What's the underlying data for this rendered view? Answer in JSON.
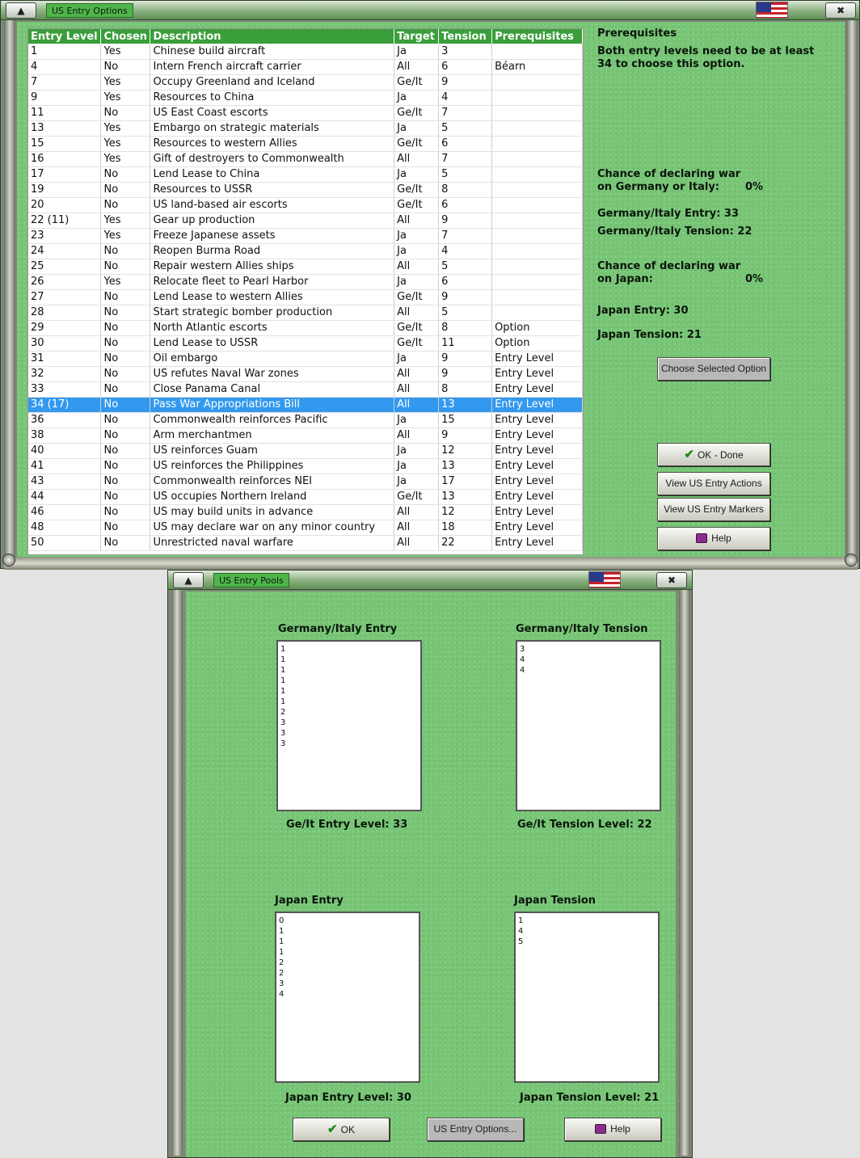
{
  "options_window": {
    "title": "US Entry Options",
    "columns": [
      "Entry Level",
      "Chosen",
      "Description",
      "Target",
      "Tension",
      "Prerequisites"
    ],
    "rows": [
      {
        "level": "1",
        "chosen": "Yes",
        "desc": "Chinese build aircraft",
        "target": "Ja",
        "tension": "3",
        "prereq": ""
      },
      {
        "level": "4",
        "chosen": "No",
        "desc": "Intern French aircraft carrier",
        "target": "All",
        "tension": "6",
        "prereq": "Béarn"
      },
      {
        "level": "7",
        "chosen": "Yes",
        "desc": "Occupy Greenland and Iceland",
        "target": "Ge/It",
        "tension": "9",
        "prereq": ""
      },
      {
        "level": "9",
        "chosen": "Yes",
        "desc": "Resources to China",
        "target": "Ja",
        "tension": "4",
        "prereq": ""
      },
      {
        "level": "11",
        "chosen": "No",
        "desc": "US East Coast escorts",
        "target": "Ge/It",
        "tension": "7",
        "prereq": ""
      },
      {
        "level": "13",
        "chosen": "Yes",
        "desc": "Embargo on strategic materials",
        "target": "Ja",
        "tension": "5",
        "prereq": ""
      },
      {
        "level": "15",
        "chosen": "Yes",
        "desc": "Resources to western Allies",
        "target": "Ge/It",
        "tension": "6",
        "prereq": ""
      },
      {
        "level": "16",
        "chosen": "Yes",
        "desc": "Gift of destroyers to Commonwealth",
        "target": "All",
        "tension": "7",
        "prereq": ""
      },
      {
        "level": "17",
        "chosen": "No",
        "desc": "Lend Lease to China",
        "target": "Ja",
        "tension": "5",
        "prereq": ""
      },
      {
        "level": "19",
        "chosen": "No",
        "desc": "Resources to USSR",
        "target": "Ge/It",
        "tension": "8",
        "prereq": ""
      },
      {
        "level": "20",
        "chosen": "No",
        "desc": "US land-based air escorts",
        "target": "Ge/It",
        "tension": "6",
        "prereq": ""
      },
      {
        "level": "22 (11)",
        "chosen": "Yes",
        "desc": "Gear up production",
        "target": "All",
        "tension": "9",
        "prereq": ""
      },
      {
        "level": "23",
        "chosen": "Yes",
        "desc": "Freeze Japanese assets",
        "target": "Ja",
        "tension": "7",
        "prereq": ""
      },
      {
        "level": "24",
        "chosen": "No",
        "desc": "Reopen Burma Road",
        "target": "Ja",
        "tension": "4",
        "prereq": ""
      },
      {
        "level": "25",
        "chosen": "No",
        "desc": "Repair western Allies ships",
        "target": "All",
        "tension": "5",
        "prereq": ""
      },
      {
        "level": "26",
        "chosen": "Yes",
        "desc": "Relocate fleet to Pearl Harbor",
        "target": "Ja",
        "tension": "6",
        "prereq": ""
      },
      {
        "level": "27",
        "chosen": "No",
        "desc": "Lend Lease to western Allies",
        "target": "Ge/It",
        "tension": "9",
        "prereq": ""
      },
      {
        "level": "28",
        "chosen": "No",
        "desc": "Start strategic bomber production",
        "target": "All",
        "tension": "5",
        "prereq": ""
      },
      {
        "level": "29",
        "chosen": "No",
        "desc": "North Atlantic escorts",
        "target": "Ge/It",
        "tension": "8",
        "prereq": "Option"
      },
      {
        "level": "30",
        "chosen": "No",
        "desc": "Lend Lease to USSR",
        "target": "Ge/It",
        "tension": "11",
        "prereq": "Option"
      },
      {
        "level": "31",
        "chosen": "No",
        "desc": "Oil embargo",
        "target": "Ja",
        "tension": "9",
        "prereq": "Entry Level"
      },
      {
        "level": "32",
        "chosen": "No",
        "desc": "US refutes Naval War zones",
        "target": "All",
        "tension": "9",
        "prereq": "Entry Level"
      },
      {
        "level": "33",
        "chosen": "No",
        "desc": "Close Panama Canal",
        "target": "All",
        "tension": "8",
        "prereq": "Entry Level"
      },
      {
        "level": "34 (17)",
        "chosen": "No",
        "desc": "Pass War Appropriations Bill",
        "target": "All",
        "tension": "13",
        "prereq": "Entry Level",
        "selected": true
      },
      {
        "level": "36",
        "chosen": "No",
        "desc": "Commonwealth reinforces Pacific",
        "target": "Ja",
        "tension": "15",
        "prereq": "Entry Level"
      },
      {
        "level": "38",
        "chosen": "No",
        "desc": "Arm merchantmen",
        "target": "All",
        "tension": "9",
        "prereq": "Entry Level"
      },
      {
        "level": "40",
        "chosen": "No",
        "desc": "US reinforces Guam",
        "target": "Ja",
        "tension": "12",
        "prereq": "Entry Level"
      },
      {
        "level": "41",
        "chosen": "No",
        "desc": "US reinforces the Philippines",
        "target": "Ja",
        "tension": "13",
        "prereq": "Entry Level"
      },
      {
        "level": "43",
        "chosen": "No",
        "desc": "Commonwealth reinforces NEI",
        "target": "Ja",
        "tension": "17",
        "prereq": "Entry Level"
      },
      {
        "level": "44",
        "chosen": "No",
        "desc": "US occupies Northern Ireland",
        "target": "Ge/It",
        "tension": "13",
        "prereq": "Entry Level"
      },
      {
        "level": "46",
        "chosen": "No",
        "desc": "US may build units in advance",
        "target": "All",
        "tension": "12",
        "prereq": "Entry Level"
      },
      {
        "level": "48",
        "chosen": "No",
        "desc": "US may declare war on any minor country",
        "target": "All",
        "tension": "18",
        "prereq": "Entry Level"
      },
      {
        "level": "50",
        "chosen": "No",
        "desc": "Unrestricted naval warfare",
        "target": "All",
        "tension": "22",
        "prereq": "Entry Level"
      }
    ],
    "side": {
      "prereq_title": "Prerequisites",
      "prereq_text_1": "Both entry levels need to be at least",
      "prereq_text_2": "34 to choose this option.",
      "chance_ge_1": "Chance of declaring war",
      "chance_ge_2": "on Germany or Italy:",
      "chance_ge_value": "0%",
      "ge_entry": "Germany/Italy Entry: 33",
      "ge_tension": "Germany/Italy Tension: 22",
      "chance_ja_1": "Chance of declaring war",
      "chance_ja_2": "on Japan:",
      "chance_ja_value": "0%",
      "ja_entry": "Japan Entry: 30",
      "ja_tension": "Japan Tension: 21"
    },
    "buttons": {
      "choose": "Choose Selected Option",
      "ok_done": "OK - Done",
      "view_actions": "View US Entry Actions",
      "view_markers": "View US Entry Markers",
      "help": "Help"
    }
  },
  "pools_window": {
    "title": "US Entry Pools",
    "ge_entry_label": "Germany/Italy Entry",
    "ge_entry_pool": [
      "1",
      "1",
      "1",
      "1",
      "1",
      "1",
      "2",
      "3",
      "3",
      "3"
    ],
    "ge_entry_level": "Ge/It Entry Level: 33",
    "ge_tension_label": "Germany/Italy Tension",
    "ge_tension_pool": [
      "3",
      "4",
      "4"
    ],
    "ge_tension_level": "Ge/It Tension Level: 22",
    "ja_entry_label": "Japan Entry",
    "ja_entry_pool": [
      "0",
      "1",
      "1",
      "1",
      "2",
      "2",
      "3",
      "4"
    ],
    "ja_entry_level": "Japan Entry Level: 30",
    "ja_tension_label": "Japan Tension",
    "ja_tension_pool": [
      "1",
      "4",
      "5"
    ],
    "ja_tension_level": "Japan Tension Level: 21",
    "buttons": {
      "ok": "OK",
      "options": "US Entry Options...",
      "help": "Help"
    }
  },
  "colors": {
    "felt": "#78c577",
    "header": "#3a9e3a",
    "selected_row": "#3399ee"
  }
}
